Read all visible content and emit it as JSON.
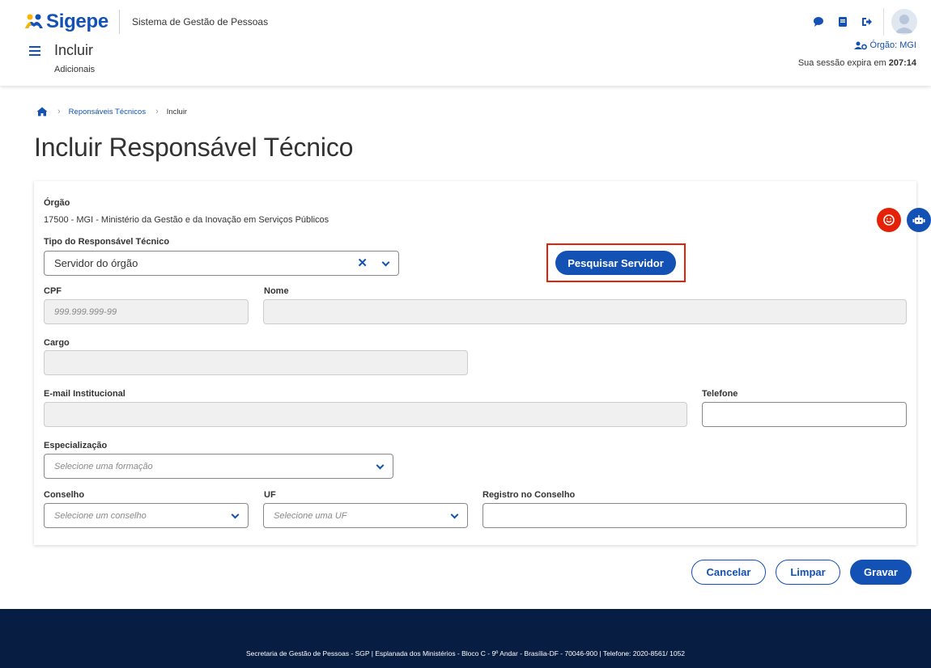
{
  "header": {
    "logo_text": "Sigepe",
    "system_name": "Sistema de Gestão de Pessoas",
    "page_context": "Incluir",
    "page_sub": "Adicionais",
    "org_label": "Órgão: MGI",
    "session_prefix": "Sua sessão expira em ",
    "session_time": "207:14"
  },
  "breadcrumb": {
    "items": [
      "Reponsáveis Técnicos",
      "Incluir"
    ]
  },
  "page_title": "Incluir Responsável Técnico",
  "form": {
    "orgao_label": "Órgão",
    "orgao_value": "17500 - MGI - Ministério da Gestão e da Inovação em Serviços Públicos",
    "tipo_label": "Tipo do Responsável Técnico",
    "tipo_value": "Servidor do órgão",
    "search_button": "Pesquisar Servidor",
    "cpf_label": "CPF",
    "cpf_placeholder": "999.999.999-99",
    "nome_label": "Nome",
    "cargo_label": "Cargo",
    "email_label": "E-mail Institucional",
    "telefone_label": "Telefone",
    "especializacao_label": "Especialização",
    "especializacao_placeholder": "Selecione uma formação",
    "conselho_label": "Conselho",
    "conselho_placeholder": "Selecione um conselho",
    "uf_label": "UF",
    "uf_placeholder": "Selecione uma UF",
    "registro_label": "Registro no Conselho"
  },
  "actions": {
    "cancel": "Cancelar",
    "clear": "Limpar",
    "save": "Gravar"
  },
  "footer": {
    "text": "Secretaria de Gestão de Pessoas - SGP | Esplanada dos Ministérios - Bloco C - 9º Andar - Brasília-DF - 70046-900 | Telefone: 2020-8561/ 1052"
  },
  "colors": {
    "primary": "#1351b4",
    "highlight": "#e52207",
    "footer_bg": "#071d41",
    "feedback_button": "#e52207"
  }
}
